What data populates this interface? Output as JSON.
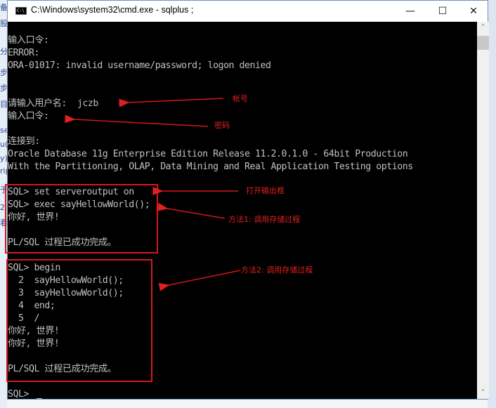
{
  "window": {
    "title": "C:\\Windows\\system32\\cmd.exe - sqlplus ;",
    "icon_label": "C:\\",
    "buttons": {
      "minimize": "—",
      "maximize": "☐",
      "close": "✕"
    }
  },
  "background_app": {
    "left_edge_fragments": [
      "备",
      "股",
      "分",
      "步",
      "步",
      "目",
      "se",
      "u(",
      "y)",
      "rip",
      "于",
      "2",
      "看"
    ]
  },
  "console": {
    "lines": [
      "输入口令:",
      "ERROR:",
      "ORA-01017: invalid username/password; logon denied",
      "",
      "",
      "请输入用户名:  jczb",
      "输入口令:",
      "",
      "连接到:",
      "Oracle Database 11g Enterprise Edition Release 11.2.0.1.0 - 64bit Production",
      "With the Partitioning, OLAP, Data Mining and Real Application Testing options",
      "",
      "SQL> set serveroutput on",
      "SQL> exec sayHellowWorld();",
      "你好, 世界!",
      "",
      "PL/SQL 过程已成功完成。",
      "",
      "SQL> begin",
      "  2  sayHellowWorld();",
      "  3  sayHellowWorld();",
      "  4  end;",
      "  5  /",
      "你好, 世界!",
      "你好, 世界!",
      "",
      "PL/SQL 过程已成功完成。",
      "",
      "SQL> "
    ]
  },
  "annotations": {
    "account": "帐号",
    "password": "密码",
    "open_output": "打开输出框",
    "method1": "方法1: 调用存储过程",
    "method2": "方法2: 调用存储过程",
    "color": "#e0201e"
  },
  "scrollbar": {
    "up_icon": "˄",
    "down_icon": "˅"
  }
}
